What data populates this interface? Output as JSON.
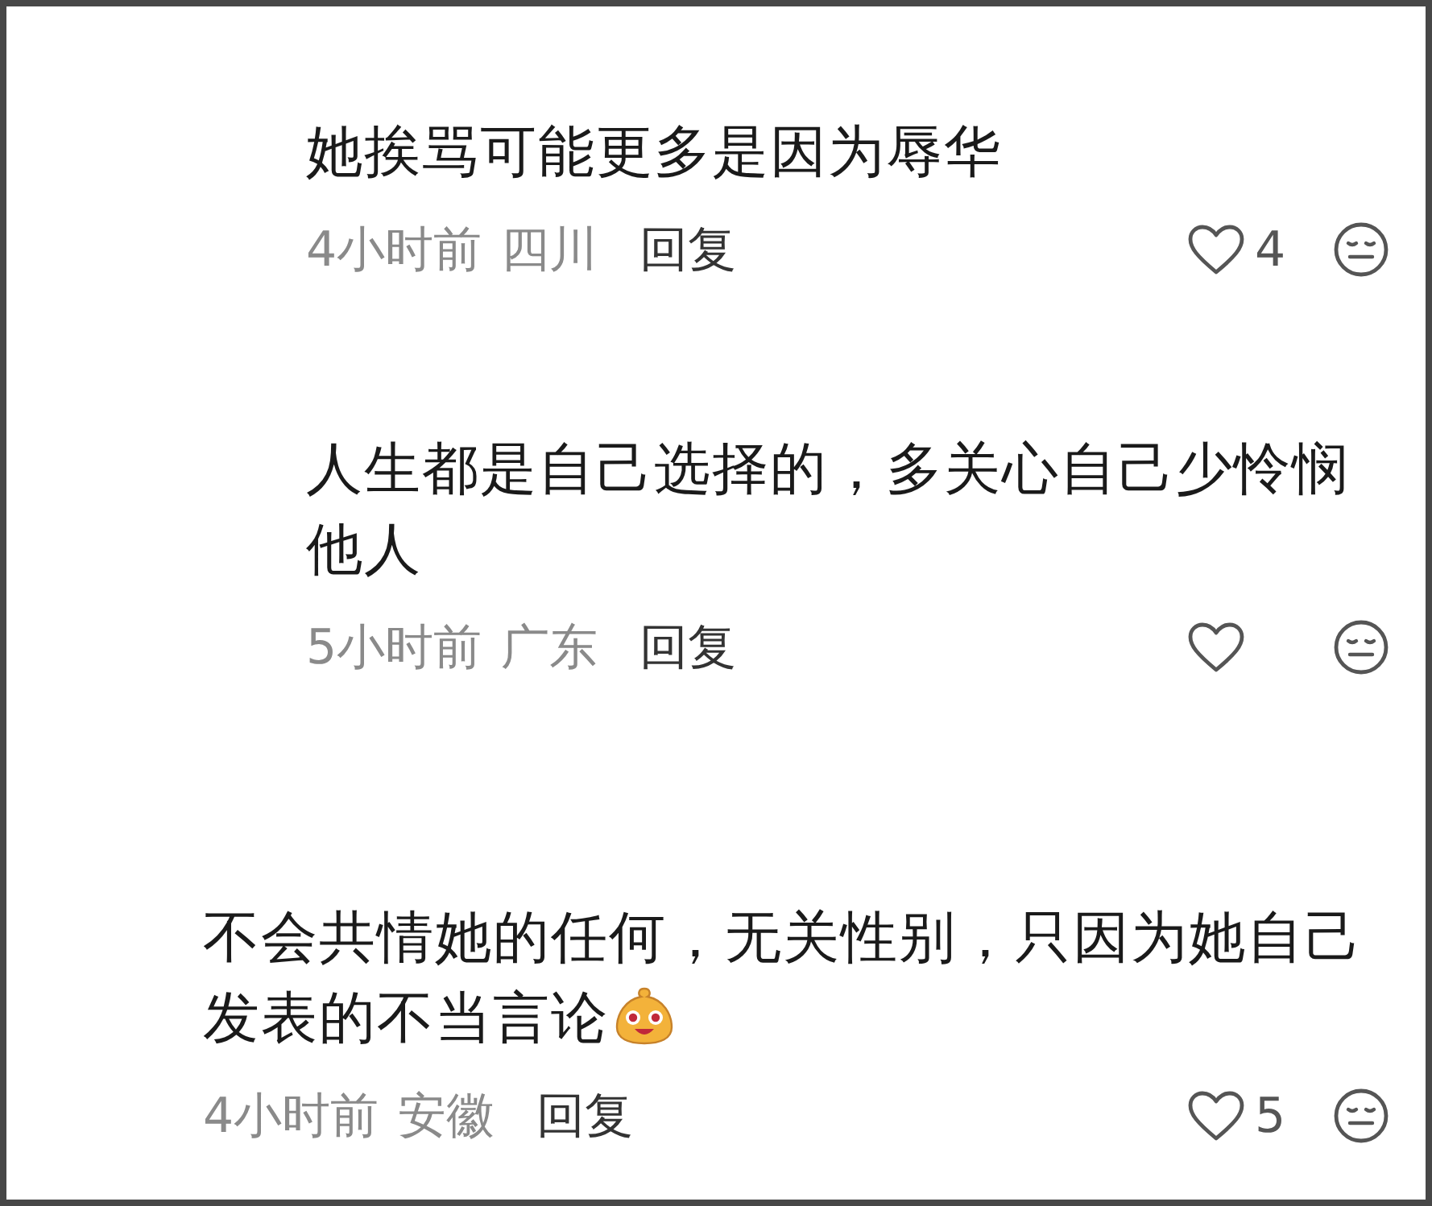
{
  "comments": [
    {
      "kind": "reply",
      "text": "她挨骂可能更多是因为辱华",
      "time": "4小时前",
      "location": "四川",
      "reply": "回复",
      "likes": "4",
      "emoji": false
    },
    {
      "kind": "reply",
      "text": "人生都是自己选择的，多关心自己少怜悯他人",
      "time": "5小时前",
      "location": "广东",
      "reply": "回复",
      "emoji": false
    },
    {
      "kind": "top",
      "text": "不会共情她的任何，无关性别，只因为她自己发表的不当言论",
      "time": "4小时前",
      "location": "安徽",
      "reply": "回复",
      "likes": "5",
      "emoji": true
    }
  ]
}
